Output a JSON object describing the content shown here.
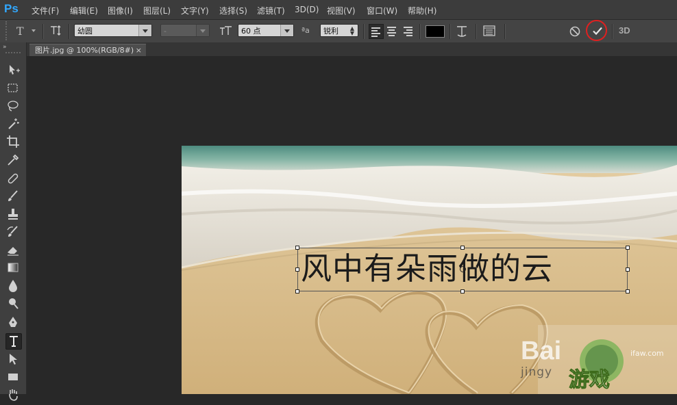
{
  "app": {
    "logo": "Ps"
  },
  "menu": [
    "文件(F)",
    "编辑(E)",
    "图像(I)",
    "图层(L)",
    "文字(Y)",
    "选择(S)",
    "滤镜(T)",
    "3D(D)",
    "视图(V)",
    "窗口(W)",
    "帮助(H)"
  ],
  "options": {
    "tool_glyph": "T",
    "font_family": "幼圆",
    "font_style": "-",
    "font_size": "60 点",
    "aa_label": "ªa",
    "antialias": "锐利",
    "label_3d": "3D"
  },
  "document": {
    "tab_title": "图片.jpg @ 100%(RGB/8#)",
    "tab_close": "×"
  },
  "text_layer": {
    "content": "风中有朵雨做的云"
  },
  "watermarks": {
    "baidu": "Bai",
    "jingyan": "jingy",
    "site": "游戏",
    "url": "ifaw.com"
  },
  "colors": {
    "text_color": "#000000",
    "commit_highlight": "#e02020",
    "ps_blue": "#31a8ff"
  }
}
